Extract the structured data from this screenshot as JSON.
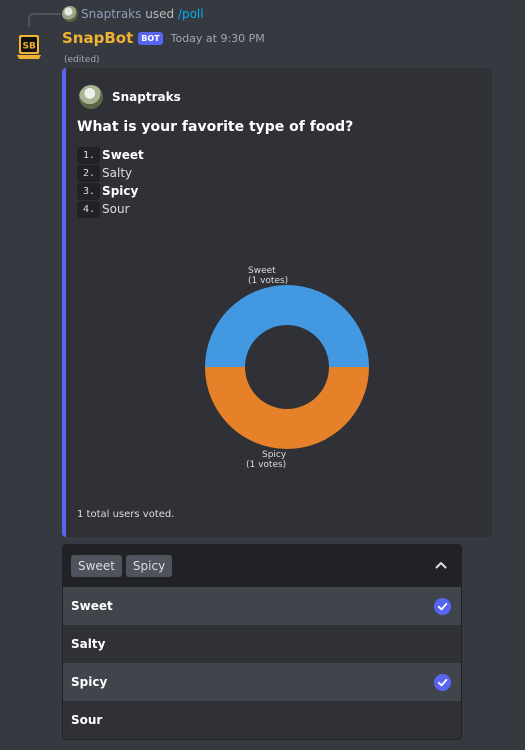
{
  "reply": {
    "user": "Snaptraks",
    "used_text": "used",
    "command": "/poll"
  },
  "message": {
    "author": "SnapBot",
    "bot_tag": "BOT",
    "timestamp": "Today at 9:30 PM",
    "edited": "(edited)"
  },
  "embed": {
    "accent_color": "#5865f2",
    "author_name": "Snaptraks",
    "title": "What is your favorite type of food?",
    "options": [
      {
        "num": "1.",
        "label": "Sweet"
      },
      {
        "num": "2.",
        "label": "Salty"
      },
      {
        "num": "3.",
        "label": "Spicy"
      },
      {
        "num": "4.",
        "label": "Sour"
      }
    ],
    "footer": "1 total users voted."
  },
  "chart_data": {
    "type": "pie",
    "style": "donut",
    "slices": [
      {
        "label": "Sweet",
        "annotation": "(1 votes)",
        "value": 1,
        "color": "#4299e1"
      },
      {
        "label": "Spicy",
        "annotation": "(1 votes)",
        "value": 1,
        "color": "#e6812a"
      }
    ]
  },
  "select_menu": {
    "selected_chips": [
      "Sweet",
      "Spicy"
    ],
    "items": [
      {
        "label": "Sweet",
        "selected": true
      },
      {
        "label": "Salty",
        "selected": false
      },
      {
        "label": "Spicy",
        "selected": true
      },
      {
        "label": "Sour",
        "selected": false
      }
    ],
    "check_color": "#5865f2"
  }
}
